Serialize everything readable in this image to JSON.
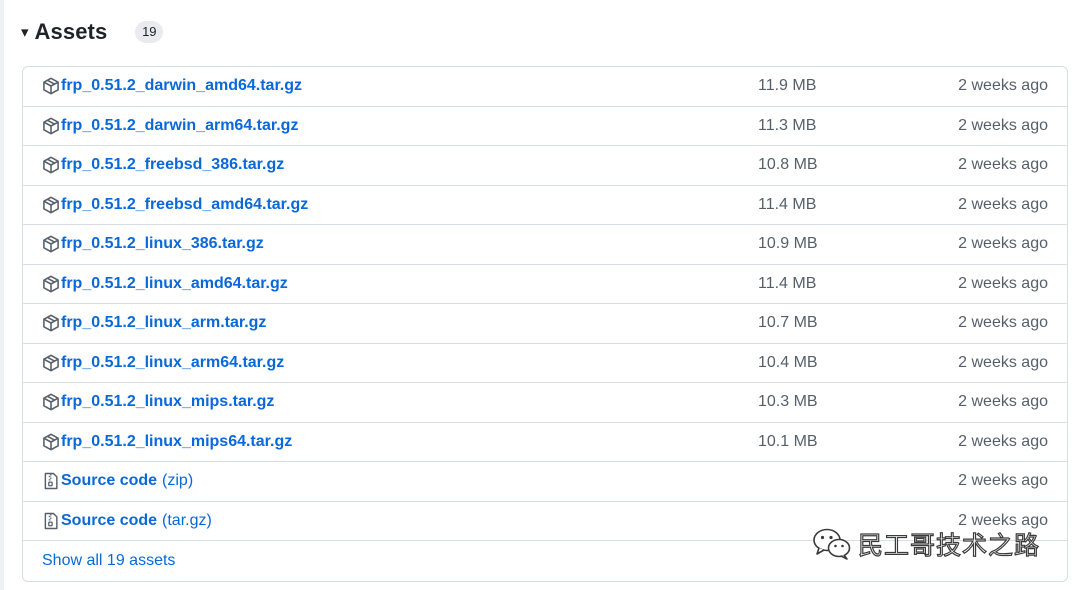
{
  "assets": {
    "caret_glyph": "▾",
    "title": "Assets",
    "count": "19",
    "rows": [
      {
        "kind": "package",
        "name": "frp_0.51.2_darwin_amd64.tar.gz",
        "size": "11.9 MB",
        "time": "2 weeks ago"
      },
      {
        "kind": "package",
        "name": "frp_0.51.2_darwin_arm64.tar.gz",
        "size": "11.3 MB",
        "time": "2 weeks ago"
      },
      {
        "kind": "package",
        "name": "frp_0.51.2_freebsd_386.tar.gz",
        "size": "10.8 MB",
        "time": "2 weeks ago"
      },
      {
        "kind": "package",
        "name": "frp_0.51.2_freebsd_amd64.tar.gz",
        "size": "11.4 MB",
        "time": "2 weeks ago"
      },
      {
        "kind": "package",
        "name": "frp_0.51.2_linux_386.tar.gz",
        "size": "10.9 MB",
        "time": "2 weeks ago"
      },
      {
        "kind": "package",
        "name": "frp_0.51.2_linux_amd64.tar.gz",
        "size": "11.4 MB",
        "time": "2 weeks ago"
      },
      {
        "kind": "package",
        "name": "frp_0.51.2_linux_arm.tar.gz",
        "size": "10.7 MB",
        "time": "2 weeks ago"
      },
      {
        "kind": "package",
        "name": "frp_0.51.2_linux_arm64.tar.gz",
        "size": "10.4 MB",
        "time": "2 weeks ago"
      },
      {
        "kind": "package",
        "name": "frp_0.51.2_linux_mips.tar.gz",
        "size": "10.3 MB",
        "time": "2 weeks ago"
      },
      {
        "kind": "package",
        "name": "frp_0.51.2_linux_mips64.tar.gz",
        "size": "10.1 MB",
        "time": "2 weeks ago"
      },
      {
        "kind": "source",
        "name": "Source code",
        "suffix": "(zip)",
        "size": "",
        "time": "2 weeks ago"
      },
      {
        "kind": "source",
        "name": "Source code",
        "suffix": "(tar.gz)",
        "size": "",
        "time": "2 weeks ago"
      }
    ],
    "show_all_label": "Show all 19 assets"
  },
  "icons": {
    "package": "package-icon",
    "source": "file-zip-icon",
    "watermark": "wechat-icon"
  },
  "watermark": {
    "text": "民工哥技术之路"
  },
  "colors": {
    "link": "#0969da",
    "muted_text": "#57606a",
    "border": "#d8dee4",
    "badge_bg": "#e9ebee"
  }
}
